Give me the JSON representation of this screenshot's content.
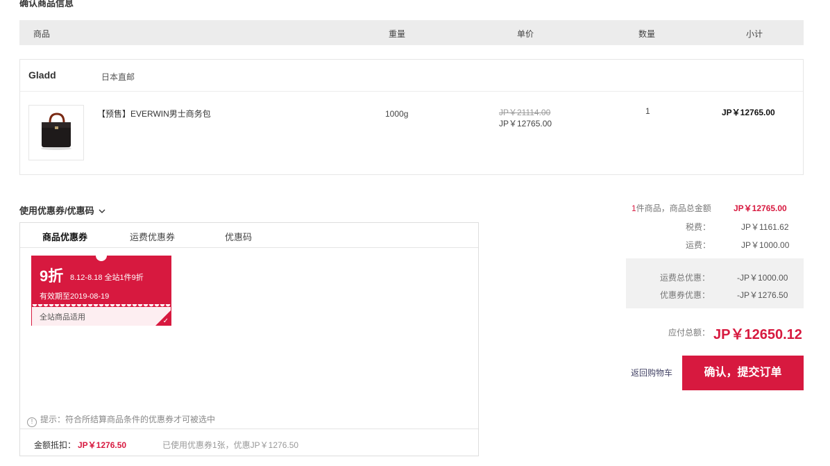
{
  "section_title": "确认商品信息",
  "table_header": {
    "product": "商品",
    "weight": "重量",
    "unit_price": "单价",
    "quantity": "数量",
    "subtotal": "小计"
  },
  "shop": {
    "name": "Gladd",
    "tag": "日本直邮",
    "item": {
      "name": "【预售】EVERWIN男士商务包",
      "weight": "1000g",
      "original_price": "JP￥21114.00",
      "price": "JP￥12765.00",
      "quantity": "1",
      "subtotal": "JP￥12765.00"
    }
  },
  "coupon_section": {
    "toggle_label": "使用优惠券/优惠码",
    "tabs": [
      "商品优惠券",
      "运费优惠券",
      "优惠码"
    ],
    "active_tab": 0,
    "coupon": {
      "big": "9折",
      "desc": "8.12-8.18 全站1件9折",
      "validity": "有效期至2019-08-19",
      "scope": "全站商品适用",
      "selected": true
    },
    "tip": "提示：符合所结算商品条件的优惠券才可被选中",
    "deduction_label": "金额抵扣：",
    "deduction_amount": "JP￥1276.50",
    "deduction_note": "已使用优惠券1张，优惠JP￥1276.50"
  },
  "summary": {
    "items_count": "1",
    "items_label": "件商品，商品总金额",
    "items_total": "JP￥12765.00",
    "tax_label": "税费：",
    "tax": "JP￥1161.62",
    "shipping_label": "运费：",
    "shipping": "JP￥1000.00",
    "shipping_discount_label": "运费总优惠：",
    "shipping_discount": "-JP￥1000.00",
    "coupon_discount_label": "优惠券优惠：",
    "coupon_discount": "-JP￥1276.50",
    "payable_label": "应付总额：",
    "payable": "JP￥12650.12"
  },
  "actions": {
    "back_label": "返回购物车",
    "submit_label": "确认，提交订单"
  },
  "colors": {
    "accent": "#d7193f",
    "header_bg": "#ececec"
  }
}
